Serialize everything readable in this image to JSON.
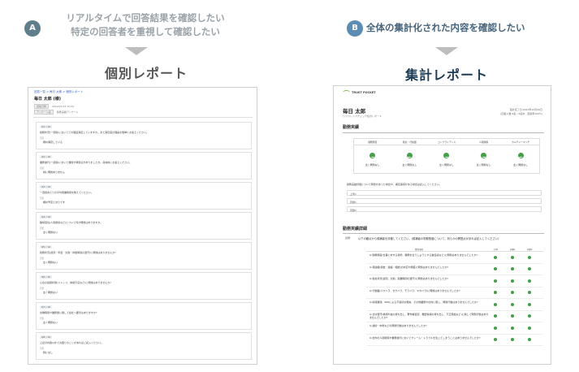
{
  "left": {
    "badge": "A",
    "headline_line1": "リアルタイムで回答結果を確認したい",
    "headline_line2": "特定の回答者を重視して確認したい",
    "title": "個別レポート",
    "report": {
      "breadcrumb": "回答一覧 > 毎日 太郎 > 個別レポート",
      "name": "毎日 太郎 (様)",
      "tag1": "回答日時",
      "tag1_value": "2022/07/13 10:20",
      "tag2": "アンケート名",
      "tag2_value": "勤務実績アンケート",
      "questions": [
        {
          "num": "Q1 / 10",
          "text": "勤務状況(一週間)においてどの程度満足していますか。また満足度の理由を簡単にお答えください。",
          "label": "回答",
          "answer": "概ね満足している"
        },
        {
          "num": "Q2 / 10",
          "text": "業務遂行(一週間)において課題や問題点がありましたか。具体的にお答えください。",
          "label": "回答",
          "answer": "特に問題ありません"
        },
        {
          "num": "Q3 / 10",
          "text": "一週間あたりの平均残業時間を教えてください。",
          "label": "回答",
          "answer": "概ね予定どおりです"
        },
        {
          "num": "Q4 / 10",
          "text": "職場環境(人間関係など)について何か問題はありますか。",
          "label": "回答",
          "answer": "全く問題ない"
        },
        {
          "num": "Q5 / 10",
          "text": "勤務状況(遅刻・早退・欠勤・休憩時間の遵守)に問題はありませんか?",
          "label": "回答",
          "answer": "全く問題ない"
        },
        {
          "num": "Q6 / 10",
          "text": "心身の健康状態(ストレス、体調不良など)に問題はありませんか?",
          "label": "回答",
          "answer": "全く問題ない"
        },
        {
          "num": "Q7 / 10",
          "text": "労働時間や業務量に関して会社へ要望はありますか?",
          "label": "回答",
          "answer": "全く問題ない"
        },
        {
          "num": "Q8 / 10",
          "text": "上記の内容以外でお困りのことがあればご記入ください。",
          "label": "回答",
          "answer": "特になし"
        }
      ]
    }
  },
  "right": {
    "badge": "B",
    "headline": "全体の集計化された内容を確認したい",
    "title": "集計レポート",
    "report": {
      "logo": "TRUST POCKET",
      "name": "毎日 太郎",
      "subtitle": "リファレンスチェック集計レポート",
      "meta_line1": "集計完了日:2022年12月26日",
      "meta_line2": "(回答人数:4名 / 4名中、回答率100%)",
      "section1": "勤務実績",
      "summary_headers": [
        "勤務態度",
        "勤怠・行動面",
        "コンプライアンス",
        "人間関係",
        "カルチャーマッチ"
      ],
      "summary_values": [
        "全く問題なし",
        "全く問題なし",
        "全く問題なし",
        "全く問題なし",
        "全く問題なし"
      ],
      "free_question": "勤務実績評価について問題があった場合や、補足事項がある場合は記入してください。",
      "free_answers": [
        "上司1",
        "同僚1",
        "同僚2"
      ],
      "section2": "勤務実績詳細",
      "detail_label": "質問:",
      "detail_question": "以下の観点から候補者を評価してください。(候補者の勤務態度について、何らかの問題点があれば記入してください)",
      "table_headers": [
        "質問項目",
        "上司1",
        "同僚1",
        "同僚2"
      ],
      "rows": [
        "Q.勤務態度(仕事に対する姿勢、職務を全うしようとする責任感など)に問題はありませんでしたか?",
        "Q.報連相(報告・連絡・相談)の対応や頻度に問題はありませんでしたか?",
        "Q.勤怠状況(遅刻、欠勤、就業時間の遵守)に問題はありませんでしたか?",
        "Q.行動面(パワハラ、セクハラ、モラハラ、マタハラ)に問題はありませんでしたか?",
        "Q.情報漏洩、SNSによる不適切な発言、その他業務や社内に関し、問題行動はありませんでしたか?",
        "Q.法令遵守(横領や金の持ち出し、著作権侵害、機密情報の持ち出し、不正受給など)に関して問題行動はありませんでしたか?",
        "Q.誹謗・中傷などの問題行動はありませんでしたか?",
        "Q.社内の人間関係や業務遂行においてクレーム・トラブルを生じてしまうことはありませんでしたか?"
      ]
    }
  }
}
